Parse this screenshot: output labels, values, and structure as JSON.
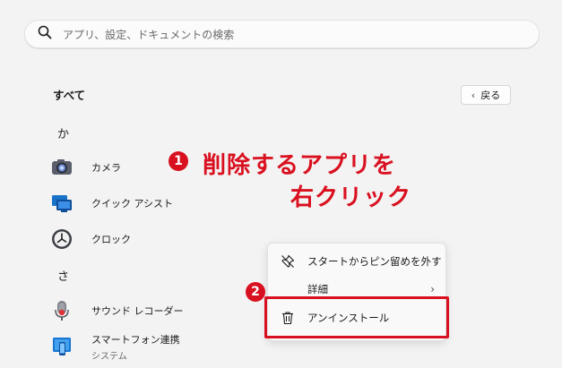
{
  "search": {
    "placeholder": "アプリ、設定、ドキュメントの検索"
  },
  "header": {
    "title": "すべて",
    "back_label": "戻る"
  },
  "groups": [
    {
      "letter": "か",
      "apps": [
        {
          "name": "カメラ",
          "icon": "camera-icon"
        },
        {
          "name": "クイック アシスト",
          "icon": "quick-assist-icon"
        },
        {
          "name": "クロック",
          "icon": "clock-icon"
        }
      ]
    },
    {
      "letter": "さ",
      "apps": [
        {
          "name": "サウンド レコーダー",
          "icon": "microphone-icon"
        },
        {
          "name": "スマートフォン連携",
          "sub": "システム",
          "icon": "phone-link-icon"
        }
      ]
    }
  ],
  "annotation": {
    "step1_number": "1",
    "step1_line1": "削除するアプリを",
    "step1_line2": "右クリック",
    "step2_number": "2",
    "color": "#d9101f"
  },
  "context_menu": {
    "items": [
      {
        "label": "スタートからピン留めを外す",
        "icon": "unpin-icon"
      },
      {
        "label": "詳細",
        "icon": "",
        "chevron": "›"
      },
      {
        "label": "アンインストール",
        "icon": "trash-icon"
      }
    ]
  }
}
